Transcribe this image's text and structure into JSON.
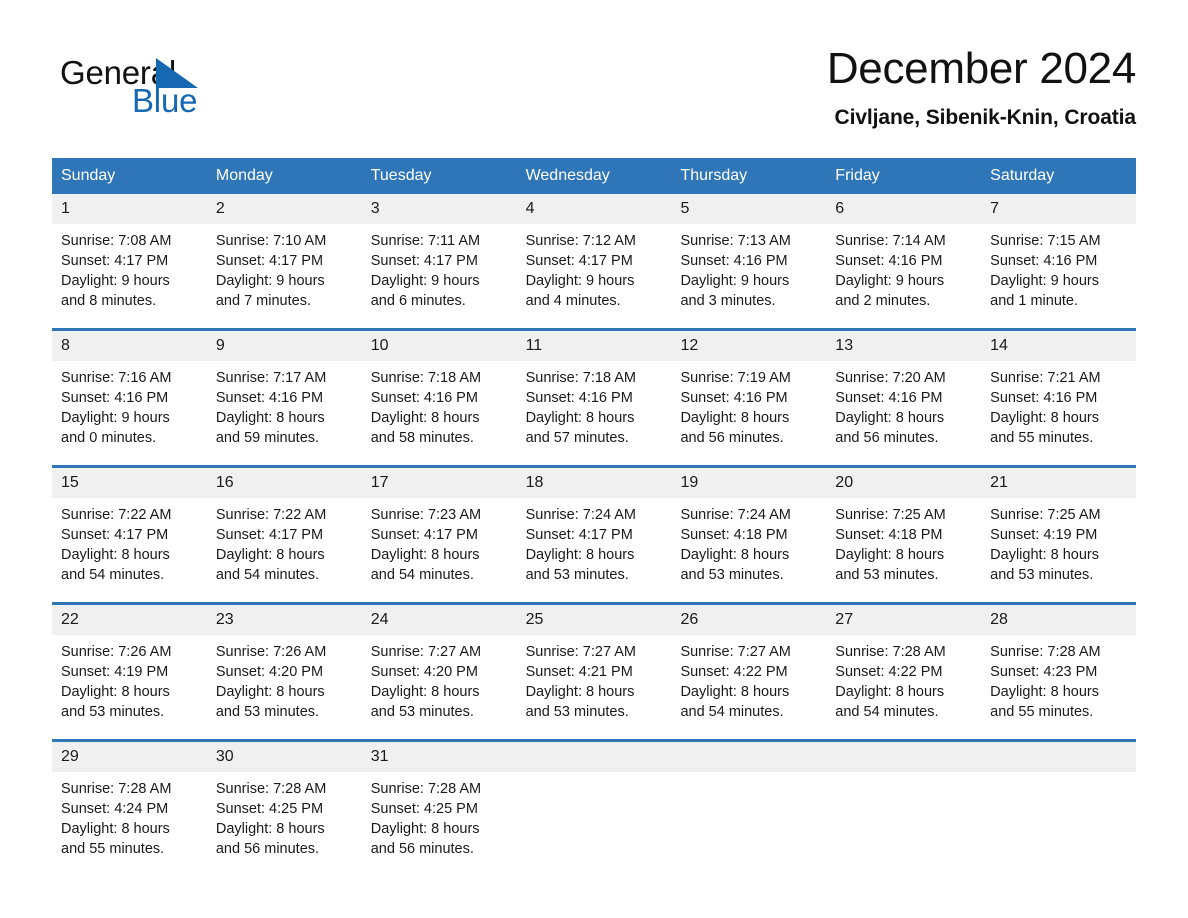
{
  "brand": {
    "name_top": "General",
    "name_bottom": "Blue",
    "accent_color": "#1668b3"
  },
  "header": {
    "title": "December 2024",
    "subtitle": "Civljane, Sibenik-Knin, Croatia"
  },
  "theme": {
    "header_blue": "#2f76b8",
    "day_band_gray": "#f0f0f0",
    "text_color": "#1a1a1a"
  },
  "weekdays": [
    "Sunday",
    "Monday",
    "Tuesday",
    "Wednesday",
    "Thursday",
    "Friday",
    "Saturday"
  ],
  "labels": {
    "sunrise_prefix": "Sunrise: ",
    "sunset_prefix": "Sunset: ",
    "daylight_prefix": "Daylight: "
  },
  "weeks": [
    [
      {
        "day": "1",
        "sunrise": "Sunrise: 7:08 AM",
        "sunset": "Sunset: 4:17 PM",
        "daylight_1": "Daylight: 9 hours",
        "daylight_2": "and 8 minutes."
      },
      {
        "day": "2",
        "sunrise": "Sunrise: 7:10 AM",
        "sunset": "Sunset: 4:17 PM",
        "daylight_1": "Daylight: 9 hours",
        "daylight_2": "and 7 minutes."
      },
      {
        "day": "3",
        "sunrise": "Sunrise: 7:11 AM",
        "sunset": "Sunset: 4:17 PM",
        "daylight_1": "Daylight: 9 hours",
        "daylight_2": "and 6 minutes."
      },
      {
        "day": "4",
        "sunrise": "Sunrise: 7:12 AM",
        "sunset": "Sunset: 4:17 PM",
        "daylight_1": "Daylight: 9 hours",
        "daylight_2": "and 4 minutes."
      },
      {
        "day": "5",
        "sunrise": "Sunrise: 7:13 AM",
        "sunset": "Sunset: 4:16 PM",
        "daylight_1": "Daylight: 9 hours",
        "daylight_2": "and 3 minutes."
      },
      {
        "day": "6",
        "sunrise": "Sunrise: 7:14 AM",
        "sunset": "Sunset: 4:16 PM",
        "daylight_1": "Daylight: 9 hours",
        "daylight_2": "and 2 minutes."
      },
      {
        "day": "7",
        "sunrise": "Sunrise: 7:15 AM",
        "sunset": "Sunset: 4:16 PM",
        "daylight_1": "Daylight: 9 hours",
        "daylight_2": "and 1 minute."
      }
    ],
    [
      {
        "day": "8",
        "sunrise": "Sunrise: 7:16 AM",
        "sunset": "Sunset: 4:16 PM",
        "daylight_1": "Daylight: 9 hours",
        "daylight_2": "and 0 minutes."
      },
      {
        "day": "9",
        "sunrise": "Sunrise: 7:17 AM",
        "sunset": "Sunset: 4:16 PM",
        "daylight_1": "Daylight: 8 hours",
        "daylight_2": "and 59 minutes."
      },
      {
        "day": "10",
        "sunrise": "Sunrise: 7:18 AM",
        "sunset": "Sunset: 4:16 PM",
        "daylight_1": "Daylight: 8 hours",
        "daylight_2": "and 58 minutes."
      },
      {
        "day": "11",
        "sunrise": "Sunrise: 7:18 AM",
        "sunset": "Sunset: 4:16 PM",
        "daylight_1": "Daylight: 8 hours",
        "daylight_2": "and 57 minutes."
      },
      {
        "day": "12",
        "sunrise": "Sunrise: 7:19 AM",
        "sunset": "Sunset: 4:16 PM",
        "daylight_1": "Daylight: 8 hours",
        "daylight_2": "and 56 minutes."
      },
      {
        "day": "13",
        "sunrise": "Sunrise: 7:20 AM",
        "sunset": "Sunset: 4:16 PM",
        "daylight_1": "Daylight: 8 hours",
        "daylight_2": "and 56 minutes."
      },
      {
        "day": "14",
        "sunrise": "Sunrise: 7:21 AM",
        "sunset": "Sunset: 4:16 PM",
        "daylight_1": "Daylight: 8 hours",
        "daylight_2": "and 55 minutes."
      }
    ],
    [
      {
        "day": "15",
        "sunrise": "Sunrise: 7:22 AM",
        "sunset": "Sunset: 4:17 PM",
        "daylight_1": "Daylight: 8 hours",
        "daylight_2": "and 54 minutes."
      },
      {
        "day": "16",
        "sunrise": "Sunrise: 7:22 AM",
        "sunset": "Sunset: 4:17 PM",
        "daylight_1": "Daylight: 8 hours",
        "daylight_2": "and 54 minutes."
      },
      {
        "day": "17",
        "sunrise": "Sunrise: 7:23 AM",
        "sunset": "Sunset: 4:17 PM",
        "daylight_1": "Daylight: 8 hours",
        "daylight_2": "and 54 minutes."
      },
      {
        "day": "18",
        "sunrise": "Sunrise: 7:24 AM",
        "sunset": "Sunset: 4:17 PM",
        "daylight_1": "Daylight: 8 hours",
        "daylight_2": "and 53 minutes."
      },
      {
        "day": "19",
        "sunrise": "Sunrise: 7:24 AM",
        "sunset": "Sunset: 4:18 PM",
        "daylight_1": "Daylight: 8 hours",
        "daylight_2": "and 53 minutes."
      },
      {
        "day": "20",
        "sunrise": "Sunrise: 7:25 AM",
        "sunset": "Sunset: 4:18 PM",
        "daylight_1": "Daylight: 8 hours",
        "daylight_2": "and 53 minutes."
      },
      {
        "day": "21",
        "sunrise": "Sunrise: 7:25 AM",
        "sunset": "Sunset: 4:19 PM",
        "daylight_1": "Daylight: 8 hours",
        "daylight_2": "and 53 minutes."
      }
    ],
    [
      {
        "day": "22",
        "sunrise": "Sunrise: 7:26 AM",
        "sunset": "Sunset: 4:19 PM",
        "daylight_1": "Daylight: 8 hours",
        "daylight_2": "and 53 minutes."
      },
      {
        "day": "23",
        "sunrise": "Sunrise: 7:26 AM",
        "sunset": "Sunset: 4:20 PM",
        "daylight_1": "Daylight: 8 hours",
        "daylight_2": "and 53 minutes."
      },
      {
        "day": "24",
        "sunrise": "Sunrise: 7:27 AM",
        "sunset": "Sunset: 4:20 PM",
        "daylight_1": "Daylight: 8 hours",
        "daylight_2": "and 53 minutes."
      },
      {
        "day": "25",
        "sunrise": "Sunrise: 7:27 AM",
        "sunset": "Sunset: 4:21 PM",
        "daylight_1": "Daylight: 8 hours",
        "daylight_2": "and 53 minutes."
      },
      {
        "day": "26",
        "sunrise": "Sunrise: 7:27 AM",
        "sunset": "Sunset: 4:22 PM",
        "daylight_1": "Daylight: 8 hours",
        "daylight_2": "and 54 minutes."
      },
      {
        "day": "27",
        "sunrise": "Sunrise: 7:28 AM",
        "sunset": "Sunset: 4:22 PM",
        "daylight_1": "Daylight: 8 hours",
        "daylight_2": "and 54 minutes."
      },
      {
        "day": "28",
        "sunrise": "Sunrise: 7:28 AM",
        "sunset": "Sunset: 4:23 PM",
        "daylight_1": "Daylight: 8 hours",
        "daylight_2": "and 55 minutes."
      }
    ],
    [
      {
        "day": "29",
        "sunrise": "Sunrise: 7:28 AM",
        "sunset": "Sunset: 4:24 PM",
        "daylight_1": "Daylight: 8 hours",
        "daylight_2": "and 55 minutes."
      },
      {
        "day": "30",
        "sunrise": "Sunrise: 7:28 AM",
        "sunset": "Sunset: 4:25 PM",
        "daylight_1": "Daylight: 8 hours",
        "daylight_2": "and 56 minutes."
      },
      {
        "day": "31",
        "sunrise": "Sunrise: 7:28 AM",
        "sunset": "Sunset: 4:25 PM",
        "daylight_1": "Daylight: 8 hours",
        "daylight_2": "and 56 minutes."
      },
      {
        "day": "",
        "sunrise": "",
        "sunset": "",
        "daylight_1": "",
        "daylight_2": ""
      },
      {
        "day": "",
        "sunrise": "",
        "sunset": "",
        "daylight_1": "",
        "daylight_2": ""
      },
      {
        "day": "",
        "sunrise": "",
        "sunset": "",
        "daylight_1": "",
        "daylight_2": ""
      },
      {
        "day": "",
        "sunrise": "",
        "sunset": "",
        "daylight_1": "",
        "daylight_2": ""
      }
    ]
  ]
}
